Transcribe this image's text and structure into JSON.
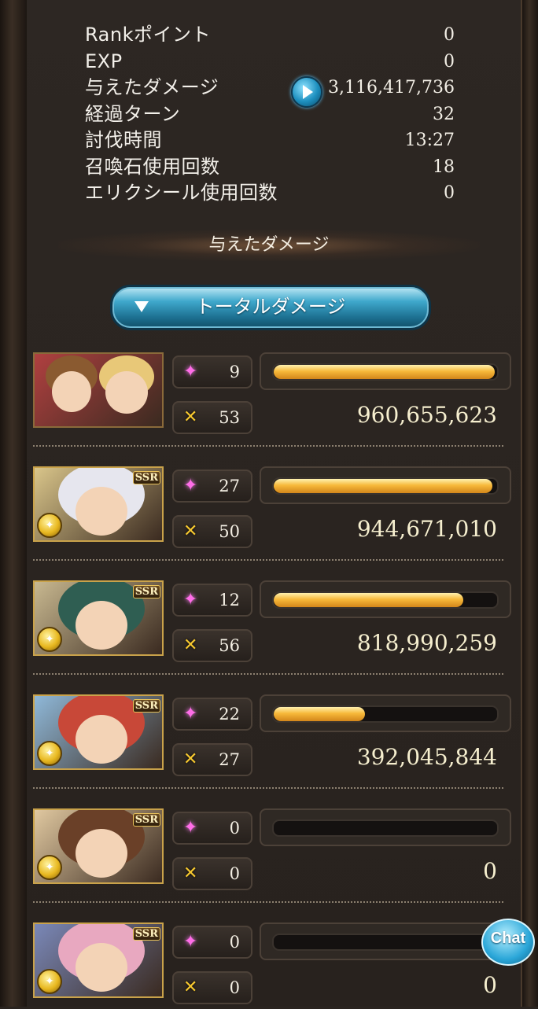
{
  "stats": [
    {
      "label": "Rankポイント",
      "value": "0"
    },
    {
      "label": "EXP",
      "value": "0"
    },
    {
      "label": "与えたダメージ",
      "value": "3,116,417,736"
    },
    {
      "label": "経過ターン",
      "value": "32"
    },
    {
      "label": "討伐時間",
      "value": "13:27"
    },
    {
      "label": "召喚石使用回数",
      "value": "18"
    },
    {
      "label": "エリクシール使用回数",
      "value": "0"
    }
  ],
  "section_title": "与えたダメージ",
  "dropdown": {
    "label": "トータルダメージ"
  },
  "characters": [
    {
      "name": "main-character",
      "skills": "9",
      "attacks": "53",
      "damage": "960,655,623",
      "bar": 0.99,
      "ssr": "",
      "hair": "#8a5a30",
      "bg": "#b04040"
    },
    {
      "name": "character-2",
      "skills": "27",
      "attacks": "50",
      "damage": "944,671,010",
      "bar": 0.98,
      "ssr": "SSR",
      "hair": "#e6e6ee",
      "bg": "#d9c58a"
    },
    {
      "name": "character-3",
      "skills": "12",
      "attacks": "56",
      "damage": "818,990,259",
      "bar": 0.85,
      "ssr": "SSR",
      "hair": "#2f5e52",
      "bg": "#c8b890"
    },
    {
      "name": "character-4",
      "skills": "22",
      "attacks": "27",
      "damage": "392,045,844",
      "bar": 0.41,
      "ssr": "SSR",
      "hair": "#c84838",
      "bg": "#8fb8d8"
    },
    {
      "name": "character-5",
      "skills": "0",
      "attacks": "0",
      "damage": "0",
      "bar": 0,
      "ssr": "SSR",
      "hair": "#6a4028",
      "bg": "#e0c8a0"
    },
    {
      "name": "character-6",
      "skills": "0",
      "attacks": "0",
      "damage": "0",
      "bar": 0,
      "ssr": "SSR",
      "hair": "#e8a8c0",
      "bg": "#7a88b8"
    }
  ],
  "chat_button": {
    "label": "Chat"
  }
}
